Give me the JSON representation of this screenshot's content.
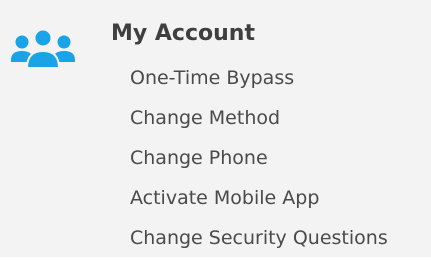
{
  "account": {
    "icon": "users-group-icon",
    "title": "My Account",
    "items": [
      {
        "label": "One-Time Bypass"
      },
      {
        "label": "Change Method"
      },
      {
        "label": "Change Phone"
      },
      {
        "label": "Activate Mobile App"
      },
      {
        "label": "Change Security Questions"
      }
    ]
  },
  "colors": {
    "background": "#f3f3f3",
    "icon": "#1aa3e6",
    "title": "#3f3f3f",
    "link": "#4a4a4a"
  }
}
